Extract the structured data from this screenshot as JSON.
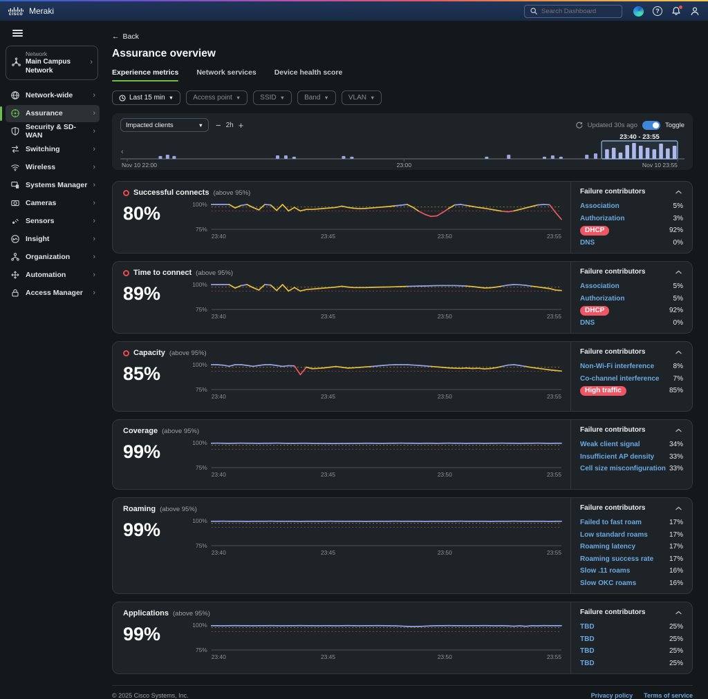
{
  "topbar": {
    "brand_cisco": "cisco",
    "brand": "Meraki",
    "search_placeholder": "Search Dashboard"
  },
  "sidebar": {
    "network_label": "Network",
    "network_name": "Main Campus Network",
    "items": [
      {
        "label": "Network-wide",
        "icon": "network-wide-icon",
        "active": false
      },
      {
        "label": "Assurance",
        "icon": "assurance-icon",
        "active": true
      },
      {
        "label": "Security & SD-WAN",
        "icon": "security-shield-icon",
        "active": false
      },
      {
        "label": "Switching",
        "icon": "switching-icon",
        "active": false
      },
      {
        "label": "Wireless",
        "icon": "wireless-icon",
        "active": false
      },
      {
        "label": "Systems Manager",
        "icon": "systems-manager-icon",
        "active": false
      },
      {
        "label": "Cameras",
        "icon": "camera-icon",
        "active": false
      },
      {
        "label": "Sensors",
        "icon": "sensor-icon",
        "active": false
      },
      {
        "label": "Insight",
        "icon": "insight-icon",
        "active": false
      },
      {
        "label": "Organization",
        "icon": "organization-icon",
        "active": false
      },
      {
        "label": "Automation",
        "icon": "automation-icon",
        "active": false
      },
      {
        "label": "Access Manager",
        "icon": "lock-icon",
        "active": false
      }
    ]
  },
  "header": {
    "back_arrow": "←",
    "back_label": "Back",
    "title": "Assurance overview",
    "tabs": [
      {
        "label": "Experience metrics",
        "active": true
      },
      {
        "label": "Network services",
        "active": false
      },
      {
        "label": "Device health score",
        "active": false
      }
    ]
  },
  "filters": {
    "items": [
      {
        "label": "Last 15 min",
        "icon": "clock-icon"
      },
      {
        "label": "Access point"
      },
      {
        "label": "SSID"
      },
      {
        "label": "Band"
      },
      {
        "label": "VLAN"
      }
    ]
  },
  "timeline": {
    "metric_select": "Impacted clients",
    "zoom_out": "−",
    "zoom_window": "2h",
    "zoom_in": "+",
    "updated": "Updated 30s ago",
    "toggle_label": "Toggle"
  },
  "chart_data": {
    "timeline": {
      "type": "bar",
      "name": "impacted-clients-timeline",
      "axis_labels": [
        {
          "text": "Nov 10 22:00",
          "pos": 0
        },
        {
          "text": "23:00",
          "pos": 0.503
        },
        {
          "text": "Nov 10 23:55",
          "pos": 1
        }
      ],
      "bars": [
        {
          "x": 0.057,
          "h": 0.17
        },
        {
          "x": 0.07,
          "h": 0.25
        },
        {
          "x": 0.082,
          "h": 0.17
        },
        {
          "x": 0.27,
          "h": 0.21
        },
        {
          "x": 0.285,
          "h": 0.21
        },
        {
          "x": 0.3,
          "h": 0.13
        },
        {
          "x": 0.39,
          "h": 0.17
        },
        {
          "x": 0.405,
          "h": 0.13
        },
        {
          "x": 0.65,
          "h": 0.13
        },
        {
          "x": 0.69,
          "h": 0.25
        },
        {
          "x": 0.755,
          "h": 0.13
        },
        {
          "x": 0.77,
          "h": 0.21
        },
        {
          "x": 0.785,
          "h": 0.13
        },
        {
          "x": 0.832,
          "h": 0.25
        },
        {
          "x": 0.848,
          "h": 0.33
        }
      ],
      "selection": {
        "label": "23:40 - 23:55",
        "start": 0.862,
        "end": 1,
        "bars": [
          0.58,
          0.67,
          0.38,
          0.83,
          0.96,
          0.79,
          0.67,
          0.58,
          0.92,
          0.63,
          0.79
        ]
      }
    },
    "metrics": [
      {
        "type": "line",
        "title": "Successful connects",
        "subtitle": "(above 95%)",
        "score": "80%",
        "alert": true,
        "ylim": [
          75,
          100
        ],
        "y_ticks": [
          "100%",
          "75%"
        ],
        "x_ticks": [
          "23:40",
          "23:45",
          "23:50",
          "23:55"
        ],
        "thresholds": {
          "warn": 97.5,
          "crit": 93.5
        },
        "values": [
          100,
          100,
          100,
          100,
          96.5,
          99,
          100,
          97,
          94.5,
          100,
          99.5,
          94,
          100,
          93.5,
          97,
          93.5,
          95,
          95,
          95.5,
          96,
          96.5,
          97,
          98.3,
          97,
          96.2,
          95.8,
          96,
          96.5,
          97,
          97.5,
          98,
          98.7,
          99.3,
          100,
          97,
          93,
          90,
          88,
          88.5,
          92,
          96,
          99.5,
          100,
          99,
          98,
          97,
          96.2,
          95.2,
          94.2,
          93.2,
          92.6,
          93.5,
          95,
          96.5,
          98,
          99.5,
          100,
          99.7,
          92,
          85
        ],
        "contributors_title": "Failure contributors",
        "contributors": [
          {
            "label": "Association",
            "value": "5%",
            "pill": false
          },
          {
            "label": "Authorization",
            "value": "3%",
            "pill": false
          },
          {
            "label": "DHCP",
            "value": "92%",
            "pill": true
          },
          {
            "label": "DNS",
            "value": "0%",
            "pill": false
          }
        ]
      },
      {
        "type": "line",
        "title": "Time to connect",
        "subtitle": "(above 95%)",
        "score": "89%",
        "alert": true,
        "ylim": [
          75,
          100
        ],
        "y_ticks": [
          "100%",
          "75%"
        ],
        "x_ticks": [
          "23:40",
          "23:45",
          "23:50",
          "23:55"
        ],
        "thresholds": {
          "warn": 97.5,
          "crit": 93.5
        },
        "values": [
          100,
          100,
          100,
          100,
          96.5,
          99,
          100,
          97,
          94.5,
          100,
          99.5,
          94,
          100,
          93.5,
          97,
          93.5,
          95,
          95.5,
          96,
          96.5,
          97,
          97.5,
          98.3,
          97.5,
          97,
          97,
          97,
          97.2,
          97.4,
          97.5,
          97.6,
          97.8,
          98,
          98.2,
          98.4,
          98.5,
          98.6,
          98.8,
          99,
          99,
          99,
          99,
          98.8,
          98.5,
          98,
          97.3,
          96.6,
          96.8,
          97.5,
          98.5,
          99.5,
          100,
          99.8,
          99.2,
          98.4,
          97.6,
          96.8,
          96,
          94.5,
          94
        ],
        "contributors_title": "Failure contributors",
        "contributors": [
          {
            "label": "Association",
            "value": "5%",
            "pill": false
          },
          {
            "label": "Authorization",
            "value": "5%",
            "pill": false
          },
          {
            "label": "DHCP",
            "value": "92%",
            "pill": true
          },
          {
            "label": "DNS",
            "value": "0%",
            "pill": false
          }
        ]
      },
      {
        "type": "line",
        "title": "Capacity",
        "subtitle": "(above 95%)",
        "score": "85%",
        "alert": true,
        "ylim": [
          75,
          100
        ],
        "y_ticks": [
          "100%",
          "75%"
        ],
        "x_ticks": [
          "23:40",
          "23:45",
          "23:50",
          "23:55"
        ],
        "thresholds": {
          "warn": 97.5,
          "crit": 93.5
        },
        "values": [
          100,
          100,
          99.5,
          98.5,
          100,
          100,
          99.3,
          98.4,
          99.2,
          100,
          100,
          99.2,
          98.3,
          99,
          98.8,
          90,
          97.5,
          96,
          96.3,
          96.8,
          97.5,
          98.2,
          97.4,
          96.6,
          96.9,
          97.3,
          97.8,
          98.2,
          98.8,
          99.3,
          99.8,
          100,
          100,
          100,
          99.6,
          99.2,
          98.8,
          98.3,
          97.8,
          97.3,
          96.8,
          96.5,
          96.3,
          96.6,
          96.2,
          96.4,
          95.8,
          96.2,
          97,
          98.3,
          99.6,
          100,
          99.2,
          98.2,
          97.2,
          96.4,
          95.6,
          94.8,
          94.2,
          93.6
        ],
        "contributors_title": "Failure contributors",
        "contributors": [
          {
            "label": "Non-Wi-Fi interference",
            "value": "8%",
            "pill": false
          },
          {
            "label": "Co-channel interference",
            "value": "7%",
            "pill": false
          },
          {
            "label": "High traffic",
            "value": "85%",
            "pill": true
          }
        ]
      },
      {
        "type": "line",
        "title": "Coverage",
        "subtitle": "(above 95%)",
        "score": "99%",
        "alert": false,
        "ylim": [
          75,
          100
        ],
        "y_ticks": [
          "100%",
          "75%"
        ],
        "x_ticks": [
          "23:40",
          "23:45",
          "23:50",
          "23:55"
        ],
        "thresholds": {
          "warn": 97.5,
          "crit": 93.5
        },
        "values": [
          99.5,
          99.6,
          99.5,
          99.4,
          99.5,
          99.6,
          99.5,
          99.5,
          99.4,
          99.5,
          99.5,
          99.6,
          99.5,
          99.4,
          99.4,
          99.5,
          99.5,
          99.4,
          99.3,
          99.3,
          99.2,
          99.2,
          99.3,
          99.3,
          99.4,
          99.4,
          99.5,
          99.5,
          99.4,
          99.4,
          99.5,
          99.5,
          99.6,
          99.5,
          99.5,
          99.4,
          99.5,
          99.5,
          99.4,
          99.5,
          99.6,
          99.5,
          99.5,
          99.4,
          99.5,
          99.5,
          99.4,
          99.5,
          99.5,
          99.6,
          99.5,
          99.5,
          99.4,
          99.5,
          99.5,
          99.6,
          99.5,
          99.4,
          99.5,
          99.5
        ],
        "contributors_title": "Failure contributors",
        "contributors": [
          {
            "label": "Weak client signal",
            "value": "34%",
            "pill": false
          },
          {
            "label": "Insufficient AP density",
            "value": "33%",
            "pill": false
          },
          {
            "label": "Cell size misconfiguration",
            "value": "33%",
            "pill": false
          }
        ]
      },
      {
        "type": "line",
        "title": "Roaming",
        "subtitle": "(above 95%)",
        "score": "99%",
        "alert": false,
        "ylim": [
          75,
          100
        ],
        "y_ticks": [
          "100%",
          "75%"
        ],
        "x_ticks": [
          "23:40",
          "23:45",
          "23:50",
          "23:55"
        ],
        "thresholds": {
          "warn": 97.5,
          "crit": 93.5
        },
        "values": [
          99.5,
          99.5,
          99.6,
          99.5,
          99.5,
          99.5,
          99.4,
          99.5,
          99.5,
          99.5,
          99.6,
          99.5,
          99.5,
          99.5,
          99.5,
          99.4,
          99.5,
          99.5,
          99.5,
          99.5,
          99.6,
          99.5,
          99.5,
          99.5,
          99.5,
          99.5,
          99.4,
          99.5,
          99.5,
          99.5,
          99.5,
          99.6,
          99.5,
          99.5,
          99.5,
          99.5,
          99.4,
          99.5,
          99.5,
          99.5,
          99.5,
          99.5,
          99.6,
          99.5,
          99.5,
          99.5,
          99.5,
          99.4,
          99.5,
          99.5,
          99.5,
          99.6,
          99.5,
          99.5,
          99.5,
          99.5,
          99.5,
          99.4,
          99.5,
          99.5
        ],
        "contributors_title": "Failure contributors",
        "contributors": [
          {
            "label": "Failed to fast roam",
            "value": "17%",
            "pill": false
          },
          {
            "label": "Low standard roams",
            "value": "17%",
            "pill": false
          },
          {
            "label": "Roaming latency",
            "value": "17%",
            "pill": false
          },
          {
            "label": "Roaming success rate",
            "value": "17%",
            "pill": false
          },
          {
            "label": "Slow .11 roams",
            "value": "16%",
            "pill": false
          },
          {
            "label": "Slow OKC roams",
            "value": "16%",
            "pill": false
          }
        ]
      },
      {
        "type": "line",
        "title": "Applications",
        "subtitle": "(above 95%)",
        "score": "99%",
        "alert": false,
        "ylim": [
          75,
          100
        ],
        "y_ticks": [
          "100%",
          "75%"
        ],
        "x_ticks": [
          "23:40",
          "23:45",
          "23:50",
          "23:55"
        ],
        "thresholds": {
          "warn": 97.5,
          "crit": 93.5
        },
        "values": [
          99.4,
          99.4,
          99.3,
          99.4,
          99.5,
          99.4,
          99.4,
          99.3,
          99.4,
          99.4,
          99.5,
          99.4,
          99.3,
          99.4,
          99.4,
          99.5,
          99.4,
          99.4,
          99.3,
          99.4,
          99.4,
          99.3,
          99.4,
          99.5,
          99.4,
          99.3,
          99.4,
          99.4,
          99.5,
          99.4,
          99.3,
          99.2,
          99,
          98.7,
          98.5,
          98.6,
          98.9,
          99.2,
          99.4,
          99.4,
          99.5,
          99.4,
          99.4,
          99.3,
          99.4,
          99.4,
          99.5,
          99.4,
          99.3,
          99.4,
          99.2,
          98.9,
          99.3,
          98.8,
          99.4,
          99.2,
          99.5,
          99.4,
          99.4,
          99.4
        ],
        "contributors_title": "Failure contributors",
        "contributors": [
          {
            "label": "TBD",
            "value": "25%",
            "pill": false
          },
          {
            "label": "TBD",
            "value": "25%",
            "pill": false
          },
          {
            "label": "TBD",
            "value": "25%",
            "pill": false
          },
          {
            "label": "TBD",
            "value": "25%",
            "pill": false
          }
        ]
      }
    ]
  },
  "footer": {
    "copyright": "© 2025 Cisco Systems, Inc.",
    "privacy": "Privacy policy",
    "terms": "Terms of service"
  }
}
